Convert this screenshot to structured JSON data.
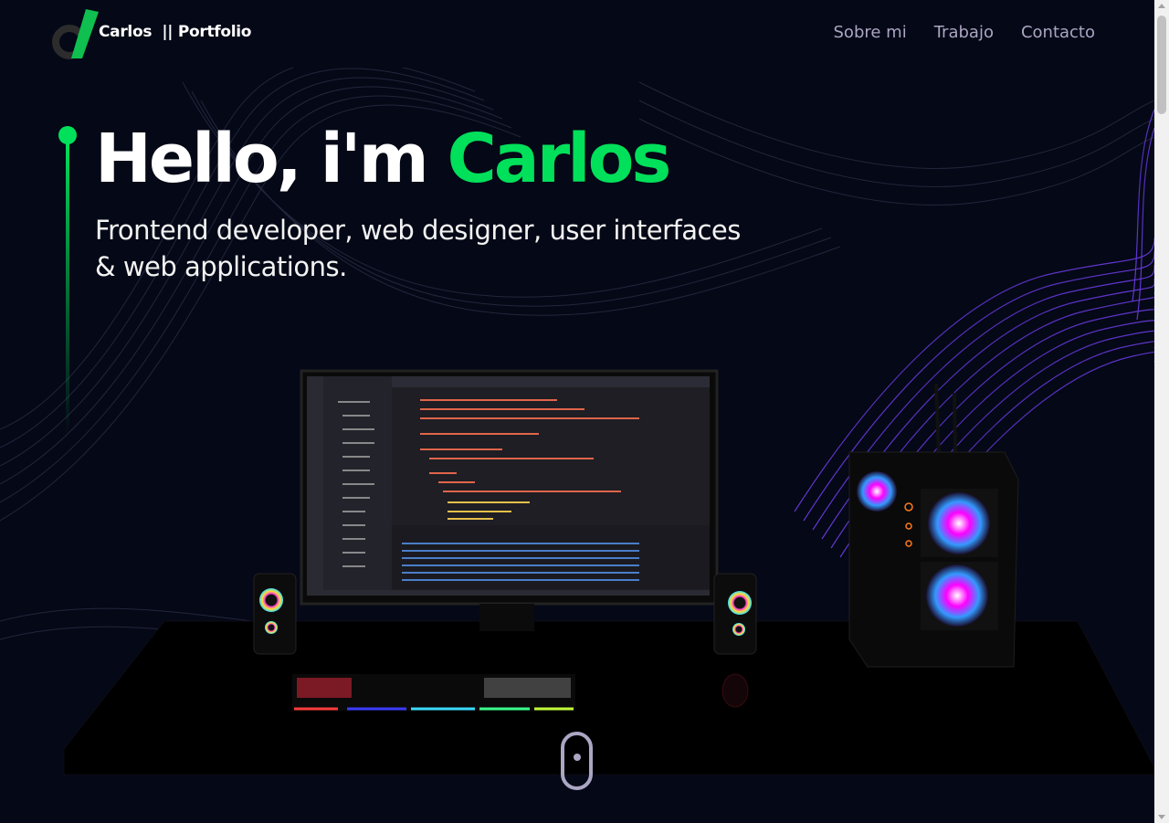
{
  "header": {
    "brand": "Carlos  || Portfolio",
    "nav": [
      {
        "label": "Sobre mi"
      },
      {
        "label": "Trabajo"
      },
      {
        "label": "Contacto"
      }
    ]
  },
  "hero": {
    "greeting": "Hello, i'm ",
    "name": "Carlos",
    "subtitle_line1": "Frontend developer, web designer, user interfaces",
    "subtitle_line2": "& web applications."
  },
  "colors": {
    "background": "#050816",
    "accent_green": "#00e05a",
    "nav_text": "#aaa6c3",
    "wave_purple": "#6d3ce8"
  },
  "icons": [
    "logo-icon",
    "scroll-down-icon"
  ]
}
